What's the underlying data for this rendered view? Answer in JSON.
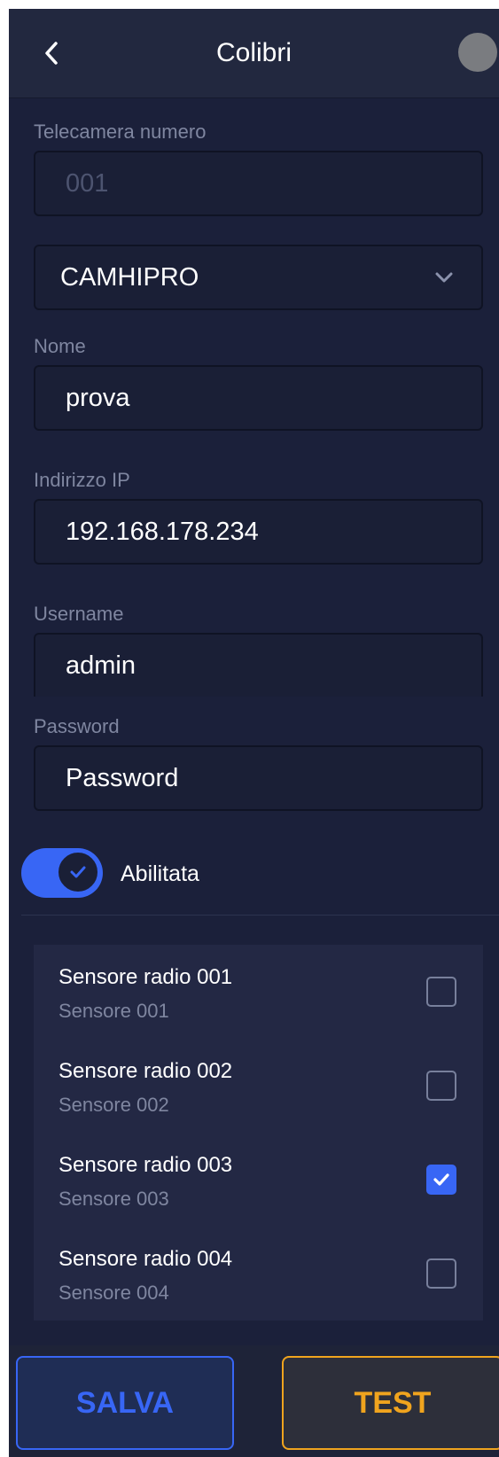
{
  "header": {
    "title": "Colibri"
  },
  "form": {
    "camera_number": {
      "label": "Telecamera numero",
      "value": "001"
    },
    "model": {
      "value": "CAMHIPRO"
    },
    "name": {
      "label": "Nome",
      "value": "prova"
    },
    "ip": {
      "label": "Indirizzo IP",
      "value": "192.168.178.234"
    },
    "username": {
      "label": "Username",
      "value": "admin"
    },
    "password": {
      "label": "Password",
      "value": "Password"
    },
    "enabled": {
      "label": "Abilitata",
      "on": true
    }
  },
  "sensors": [
    {
      "name": "Sensore radio 001",
      "sub": "Sensore 001",
      "checked": false
    },
    {
      "name": "Sensore radio 002",
      "sub": "Sensore 002",
      "checked": false
    },
    {
      "name": "Sensore radio 003",
      "sub": "Sensore 003",
      "checked": true
    },
    {
      "name": "Sensore radio 004",
      "sub": "Sensore 004",
      "checked": false
    }
  ],
  "actions": {
    "save_label": "SALVA",
    "test_label": "TEST"
  },
  "colors": {
    "accent": "#3866f5",
    "test": "#f0a41e",
    "background": "#1b203a"
  }
}
